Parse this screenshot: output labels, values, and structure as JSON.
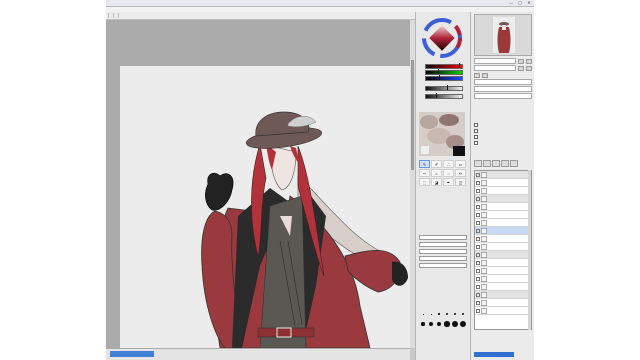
{
  "window": {
    "title": "",
    "buttons": [
      "—",
      "▢",
      "✕"
    ]
  },
  "menubar": {
    "items": []
  },
  "toolbar": {
    "items": []
  },
  "canvas": {
    "zoom_label": "",
    "colors": {
      "background": "#ababab",
      "paper": "#ececec",
      "coat": "#9a3a3e",
      "hair": "#b2323c",
      "shirt": "#5b5753",
      "hat": "#6f5956"
    }
  },
  "color_panel": {
    "wheel_hue": "#b0243a",
    "sliders": [
      {
        "color": "red",
        "level": 0.95
      },
      {
        "color": "green",
        "level": 0.35
      },
      {
        "color": "blue",
        "level": 0.4
      },
      {
        "color": "value",
        "level": 0.6
      },
      {
        "color": "value",
        "level": 0.3
      }
    ]
  },
  "tools": {
    "items": [
      {
        "name": "pen-tool-icon",
        "glyph": "✎"
      },
      {
        "name": "brush-tool-icon",
        "glyph": "✐"
      },
      {
        "name": "airbrush-tool-icon",
        "glyph": "∴"
      },
      {
        "name": "eraser-tool-icon",
        "glyph": "▭"
      },
      {
        "name": "marker-tool-icon",
        "glyph": "✑"
      },
      {
        "name": "watercolor-tool-icon",
        "glyph": "≈"
      },
      {
        "name": "blur-tool-icon",
        "glyph": "◌"
      },
      {
        "name": "pencil-tool-icon",
        "glyph": "✏"
      },
      {
        "name": "select-tool-icon",
        "glyph": "⬚"
      },
      {
        "name": "fill-tool-icon",
        "glyph": "◪"
      },
      {
        "name": "binary-pen-icon",
        "glyph": "✒"
      },
      {
        "name": "selection-eraser-icon",
        "glyph": "◫"
      }
    ]
  },
  "brush_sizes": [
    0.5,
    0.7,
    1,
    1.5,
    2,
    2.3,
    2.6,
    3,
    3.5,
    4,
    4.5,
    5
  ]
}
